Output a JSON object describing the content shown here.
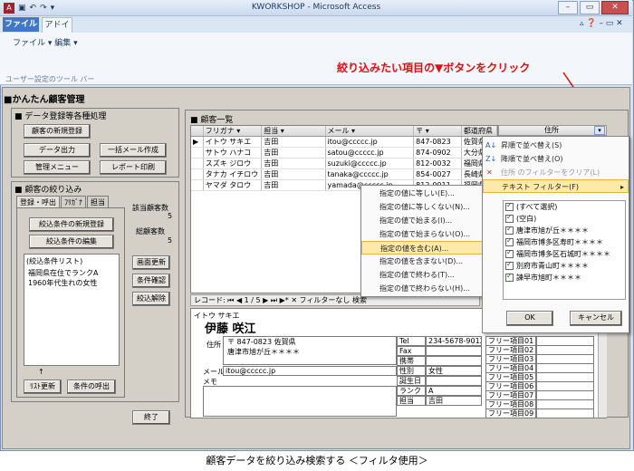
{
  "window": {
    "title": "KWORKSHOP - Microsoft Access"
  },
  "ribbon": {
    "tab_file": "ファイル",
    "tab_addin": "アドイン",
    "menu": "ファイル ▾  編集 ▾",
    "footer": "ユーザー設定のツール バー"
  },
  "annotation": "絞り込みたい項目の▼ボタンをクリック",
  "app": {
    "title": "■かんたん顧客管理"
  },
  "left": {
    "group1_title": "■ データ登録等各種処理",
    "btn_new": "顧客の新規登録",
    "btn_export": "データ出力",
    "btn_mail": "一括メール作成",
    "btn_admin": "管理メニュー",
    "btn_report": "レポート印刷",
    "group2_title": "■ 顧客の絞り込み",
    "tabs": [
      "登録・呼出",
      "ﾌﾘｶﾞﾅ",
      "担当"
    ],
    "btn_newcond": "絞込条件の新規登録",
    "btn_editcond": "絞込条件の編集",
    "list_title": "(絞込条件リスト)",
    "list_items": [
      "福岡県在住でランクA",
      "1960年代生れの女性"
    ],
    "arrow": "↑",
    "btn_refresh": "ﾘｽﾄ更新",
    "btn_recall": "条件の呼出",
    "count_label": "該当顧客数",
    "count_value": "5",
    "total_label": "総顧客数",
    "total_value": "5",
    "btn_screen": "画面更新",
    "btn_confirm": "条件確認",
    "btn_clear": "絞込解除",
    "btn_exit": "終了"
  },
  "sheet": {
    "title": "■ 顧客一覧",
    "headers": [
      "フリガナ",
      "担当",
      "メール",
      "〒",
      "都道府県",
      "住所"
    ],
    "rows": [
      [
        "イトウ サキエ",
        "吉田",
        "itou@ccccc.jp",
        "847-0823",
        "佐賀県",
        ""
      ],
      [
        "サトウ ハナコ",
        "吉田",
        "satou@ccccc.jp",
        "874-0902",
        "大分県",
        ""
      ],
      [
        "スズキ ジロウ",
        "吉田",
        "suzuki@ccccc.jp",
        "812-0032",
        "福岡県",
        ""
      ],
      [
        "タナカ イチロウ",
        "吉田",
        "tanaka@ccccc.jp",
        "854-0027",
        "長崎県",
        ""
      ],
      [
        "ヤマダ タロウ",
        "吉田",
        "yamada@ccccc.jp",
        "812-0011",
        "福岡県",
        ""
      ]
    ],
    "nav": "レコード: ⏮ ◀ 1 / 5 ▶ ⏭ ▶*   ✕ フィルターなし   検索"
  },
  "menu_text": {
    "items": [
      "指定の値に等しい(E)...",
      "指定の値に等しくない(N)...",
      "指定の値で始まる(I)...",
      "指定の値で始まらない(O)...",
      "指定の値を含む(A)...",
      "指定の値を含まない(D)...",
      "指定の値で終わる(T)...",
      "指定の値で終わらない(H)..."
    ],
    "highlighted": 4
  },
  "menu_sort": {
    "asc": "昇順で並べ替え(S)",
    "desc": "降順で並べ替え(O)",
    "clear": "住所 のフィルターをクリア(L)",
    "textfilter": "テキスト フィルター(F)",
    "checks": [
      "(すべて選択)",
      "(空白)",
      "唐津市旭が丘＊＊＊＊",
      "福岡市博多区寿町＊＊＊＊",
      "福岡市博多区石城町＊＊＊＊",
      "別府市青山町＊＊＊＊",
      "諫早市旭町＊＊＊＊"
    ],
    "ok": "OK",
    "cancel": "キャンセル"
  },
  "detail": {
    "kana": "イトウ サキエ",
    "name": "伊藤 咲江",
    "addr_label": "住所",
    "zip": "〒 847-0823  佐賀県",
    "addr": "唐津市旭が丘＊＊＊＊",
    "mail_label": "メール",
    "mail": "itou@ccccc.jp",
    "memo_label": "メモ",
    "tel_label": "Tel",
    "tel": "234-5678-9012",
    "fax_label": "Fax",
    "fax": "",
    "mobile_label": "携帯",
    "mobile": "",
    "sex_label": "性別",
    "sex": "女性",
    "birth_label": "誕生日",
    "birth": "",
    "rank_label": "ランク",
    "rank": "A",
    "staff_label": "担当",
    "staff": "吉田",
    "free": [
      "フリー項目01",
      "フリー項目02",
      "フリー項目03",
      "フリー項目04",
      "フリー項目05",
      "フリー項目06",
      "フリー項目07",
      "フリー項目08",
      "フリー項目09"
    ]
  },
  "caption": "顧客データを絞り込み検索する ＜フィルタ使用＞"
}
